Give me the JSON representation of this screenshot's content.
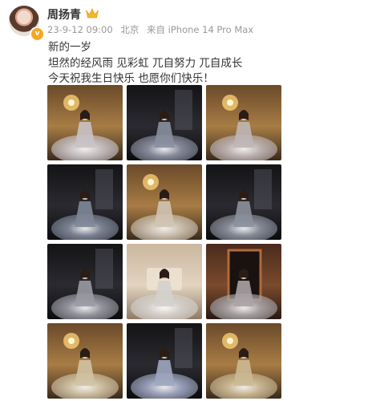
{
  "post": {
    "username": "周扬青",
    "date": "23-9-12 09:00",
    "location": "北京",
    "source": "来自 iPhone 14 Pro Max",
    "lines": [
      "新的一岁",
      "坦然的经风雨 见彩虹 兀自努力 兀自成长",
      "今天祝我生日快乐 也愿你们快乐！"
    ],
    "badge_icon": "crown-icon",
    "verified_icon": "verified-v-icon"
  },
  "photos": [
    {
      "scene": "gold-hall",
      "gown": "#c9c2c6"
    },
    {
      "scene": "dark-room",
      "gown": "#8a8fa0"
    },
    {
      "scene": "gold-hall",
      "gown": "#bfb6b6"
    },
    {
      "scene": "dark-room",
      "gown": "#7f8798"
    },
    {
      "scene": "gold-hall",
      "gown": "#cfc3b2"
    },
    {
      "scene": "dark-room",
      "gown": "#8b909c"
    },
    {
      "scene": "dark-room",
      "gown": "#9a9aa4"
    },
    {
      "scene": "bedroom",
      "gown": "#d4d0cc"
    },
    {
      "scene": "doorway",
      "gown": "#a8a4a6"
    },
    {
      "scene": "gold-hall",
      "gown": "#d2c2a4"
    },
    {
      "scene": "dark-room",
      "gown": "#9ea6c0"
    },
    {
      "scene": "gold-hall",
      "gown": "#cbb994"
    }
  ]
}
